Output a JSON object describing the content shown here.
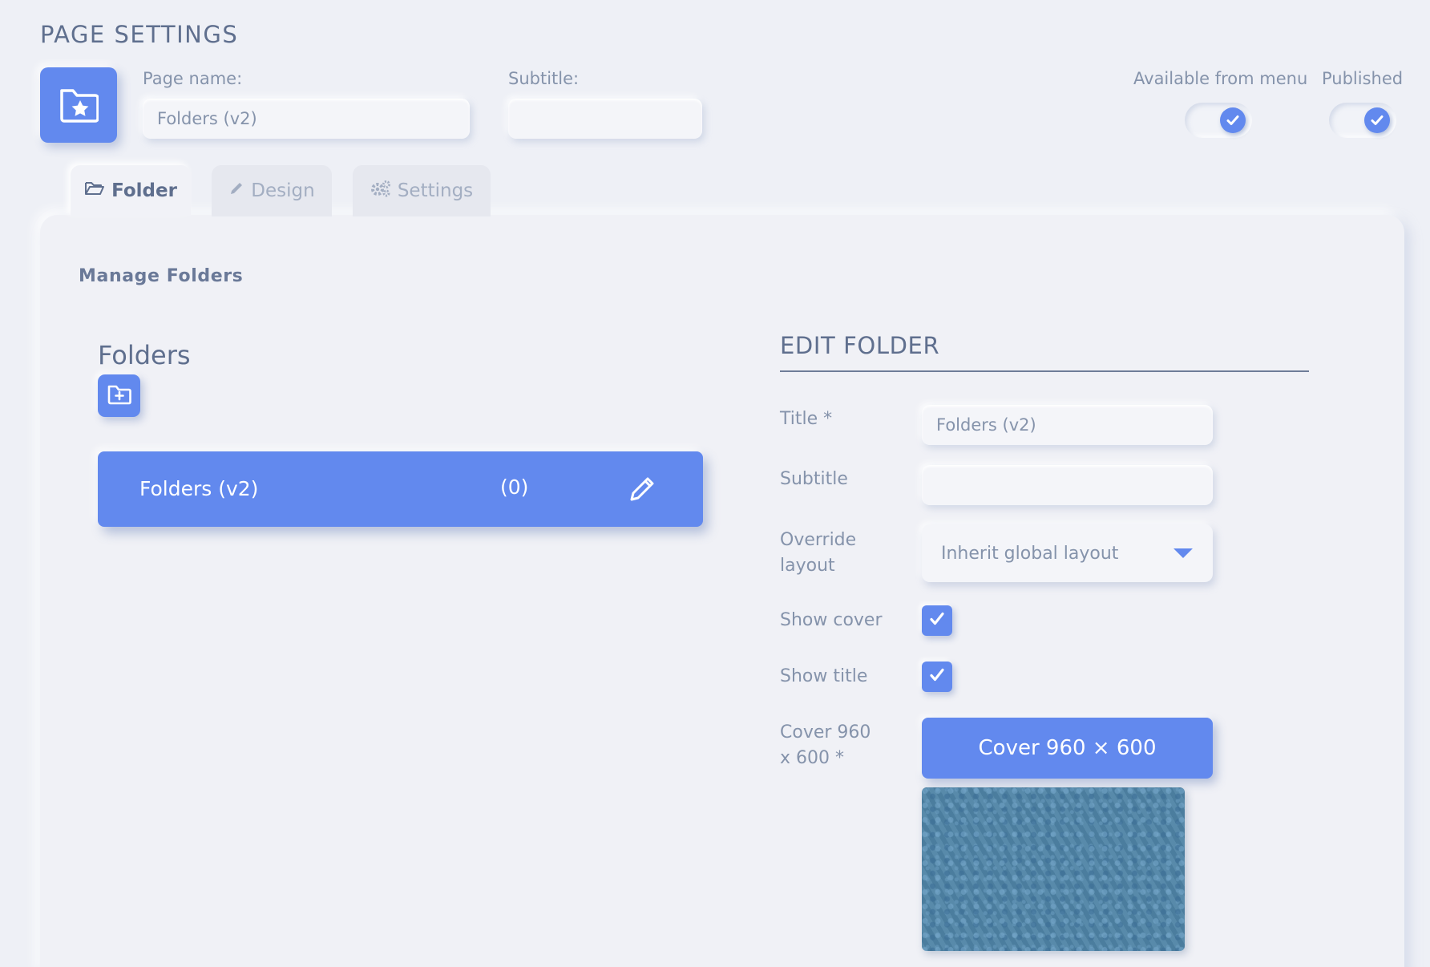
{
  "page": {
    "title": "PAGE SETTINGS",
    "page_name_label": "Page name:",
    "page_name_value": "Folders (v2)",
    "subtitle_label": "Subtitle:",
    "subtitle_value": "",
    "toggles": [
      {
        "label": "Available from menu",
        "checked": true
      },
      {
        "label": "Published",
        "checked": true
      }
    ]
  },
  "tabs": [
    {
      "label": "Folder",
      "icon": "folder-open-icon",
      "active": true
    },
    {
      "label": "Design",
      "icon": "pencil-icon",
      "active": false
    },
    {
      "label": "Settings",
      "icon": "gears-icon",
      "active": false
    }
  ],
  "manage": {
    "section_title": "Manage Folders",
    "folders_heading": "Folders",
    "folders": [
      {
        "name": "Folders (v2)",
        "count": "(0)"
      }
    ]
  },
  "edit": {
    "heading": "EDIT FOLDER",
    "title_label": "Title *",
    "title_value": "Folders (v2)",
    "subtitle_label": "Subtitle",
    "subtitle_value": "",
    "override_label_line1": "Override",
    "override_label_line2": "layout",
    "override_value": "Inherit global layout",
    "show_cover_label": "Show cover",
    "show_cover": true,
    "show_title_label": "Show title",
    "show_title": true,
    "cover_label_line1": "Cover 960",
    "cover_label_line2": "x 600 *",
    "cover_button": "Cover 960 × 600"
  },
  "colors": {
    "accent": "#6289ee",
    "background": "#eef0f6",
    "text": "#6b7a96"
  }
}
